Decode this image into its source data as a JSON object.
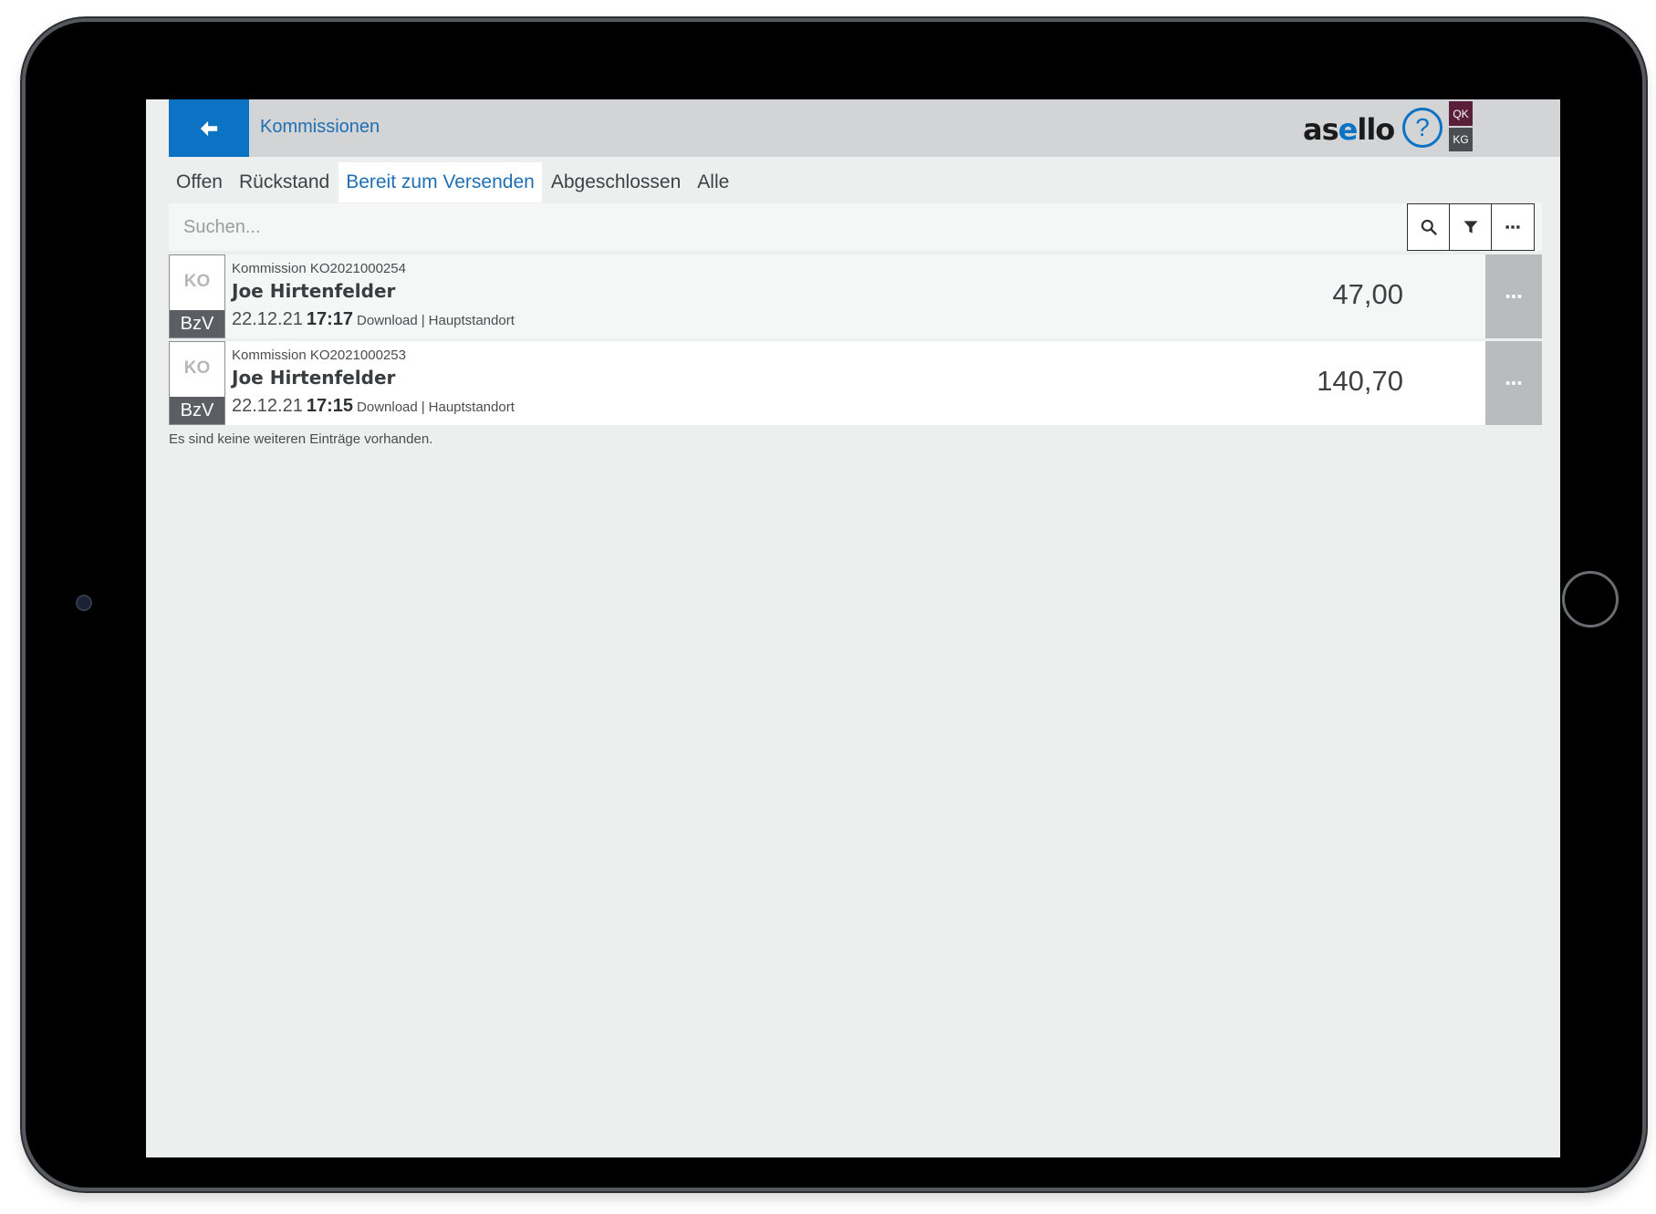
{
  "header": {
    "title": "Kommissionen",
    "logo_prefix": "as",
    "logo_accent": "e",
    "logo_suffix": "llo",
    "help_symbol": "?",
    "badge_top": "QK",
    "badge_bottom": "KG"
  },
  "tabs": [
    {
      "label": "Offen",
      "active": false
    },
    {
      "label": "Rückstand",
      "active": false
    },
    {
      "label": "Bereit zum Versenden",
      "active": true
    },
    {
      "label": "Abgeschlossen",
      "active": false
    },
    {
      "label": "Alle",
      "active": false
    }
  ],
  "search": {
    "placeholder": "Suchen..."
  },
  "items": [
    {
      "type_top": "KO",
      "type_bottom": "BzV",
      "subtitle": "Kommission KO2021000254",
      "name": "Joe Hirtenfelder",
      "date": "22.12.21",
      "time": "17:17",
      "source": "Download",
      "separator": "|",
      "location": "Hauptstandort",
      "amount": "47,00"
    },
    {
      "type_top": "KO",
      "type_bottom": "BzV",
      "subtitle": "Kommission KO2021000253",
      "name": "Joe Hirtenfelder",
      "date": "22.12.21",
      "time": "17:15",
      "source": "Download",
      "separator": "|",
      "location": "Hauptstandort",
      "amount": "140,70"
    }
  ],
  "footer_text": "Es sind keine weiteren Einträge vorhanden.",
  "colors": {
    "accent": "#0b72c4",
    "header_bg": "#d3d4d6",
    "badge_qk": "#5a1f3a",
    "badge_kg": "#4a4d51",
    "type_label_bg": "#5b5e62"
  },
  "icons": {
    "back": "arrow-left-icon",
    "help": "question-circle-icon",
    "search": "search-icon",
    "filter": "filter-icon",
    "more": "ellipsis-icon"
  }
}
